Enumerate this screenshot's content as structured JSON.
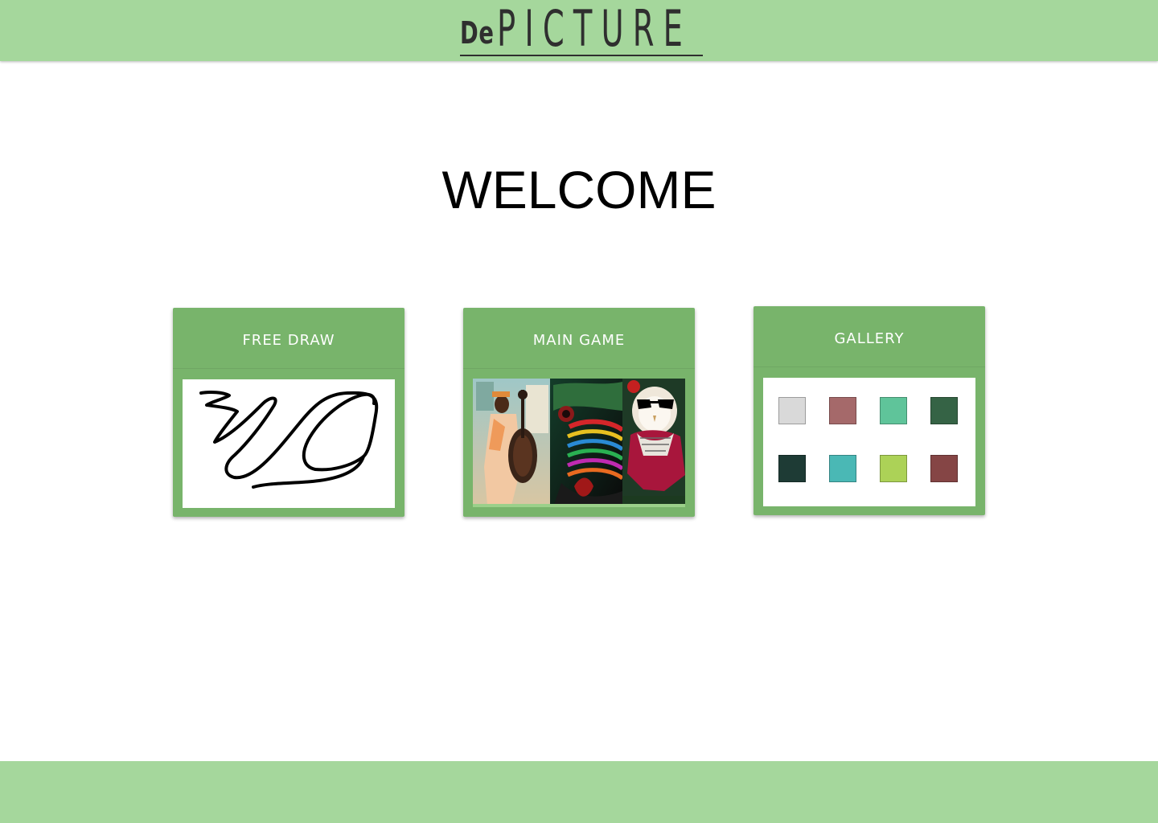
{
  "header": {
    "logo_prefix": "De",
    "logo_main": "PICTURE",
    "background_color": "#a5d79c"
  },
  "welcome": {
    "text": "WELCOME"
  },
  "cards": {
    "free_draw": {
      "title": "FREE DRAW"
    },
    "main_game": {
      "title": "MAIN GAME"
    },
    "gallery": {
      "title": "GALLERY",
      "swatches": [
        "#d9d9d9",
        "#a5696a",
        "#5fc49a",
        "#356345",
        "#1e3b35",
        "#4ab8b5",
        "#acd257",
        "#854545"
      ]
    }
  },
  "colors": {
    "card": "#78b46b",
    "header_footer": "#a5d79c"
  }
}
